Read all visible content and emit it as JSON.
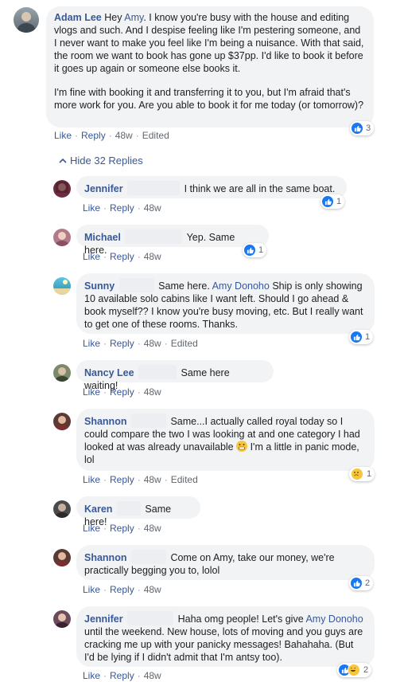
{
  "post": {
    "author": "Adam Lee",
    "pre": "Hey ",
    "mention": "Amy",
    "text1": ". I know you're busy with the house and editing vlogs and such. And I despise feeling like I'm pestering someone, and I never want to make you feel like I'm being a nuisance. With that said, the room we want to book has gone up $37pp. I'd like to book it before it goes up again or someone else books it.",
    "text2": "I'm fine with booking it and transferring it to you, but I'm afraid that's more work for you. Are you able to book it for me today (or tomorrow)?",
    "reactions": "3",
    "like": "Like",
    "reply": "Reply",
    "time": "48w",
    "edited": "Edited"
  },
  "hide_replies": "Hide 32 Replies",
  "replies": [
    {
      "author": "Jennifer",
      "text": "I think we are all in the same boat.",
      "reactions": "1",
      "time": "48w"
    },
    {
      "author": "Michael",
      "text": "Yep. Same here.",
      "reactions": "1",
      "time": "48w"
    },
    {
      "author": "Sunny",
      "pre": "Same here. ",
      "mention": "Amy Donoho",
      "text": " Ship is only showing 10 available solo cabins like I want left. Should I go ahead & book myself?? I know you're busy moving, etc. But I really want to get one of these rooms. Thanks.",
      "reactions": "1",
      "time": "48w",
      "edited": "Edited"
    },
    {
      "author": "Nancy Lee",
      "text": "Same here waiting!",
      "time": "48w"
    },
    {
      "author": "Shannon",
      "text": "Same...I actually called royal today so I could compare the two I was looking at and one category I had looked at was already unavailable",
      "text_after": " I'm a little in panic mode, lol",
      "reactions": "1",
      "time": "48w",
      "edited": "Edited"
    },
    {
      "author": "Karen",
      "text": "Same here!",
      "time": "48w"
    },
    {
      "author": "Shannon",
      "text": "Come on Amy, take our money, we're practically begging you to, lolol",
      "reactions": "2",
      "time": "48w"
    },
    {
      "author": "Jennifer",
      "pre": "Haha omg people! Let's give ",
      "mention": "Amy Donoho",
      "text": " until the weekend. New house, lots of moving and you guys are cracking me up with your panicky messages! Bahahaha. (But I'd be lying if I didn't admit that I'm antsy too).",
      "reactions": "2",
      "time": "48w"
    }
  ],
  "labels": {
    "like": "Like",
    "reply": "Reply"
  },
  "colors": {
    "link": "#385898",
    "bubble": "#f2f3f5",
    "like_blue": "#1877f2"
  }
}
